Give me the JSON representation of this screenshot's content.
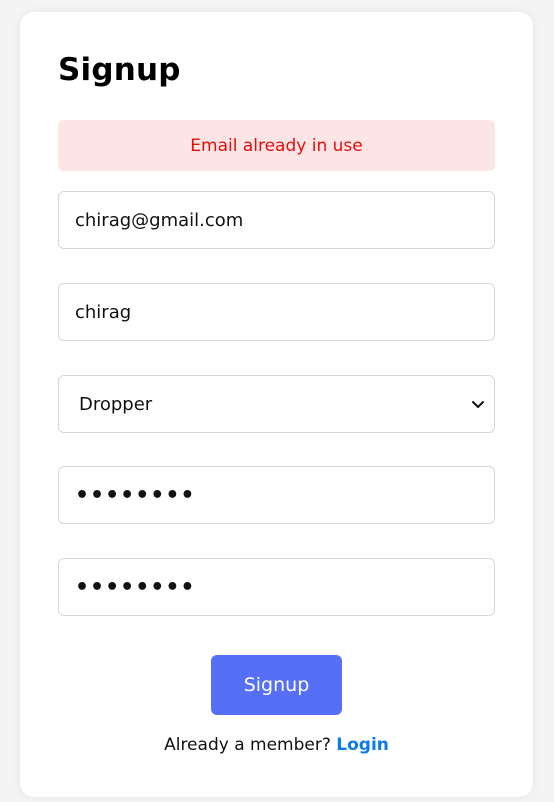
{
  "form": {
    "title": "Signup",
    "error": "Email already in use",
    "email": "chirag@gmail.com",
    "name": "chirag",
    "role": "Dropper",
    "password": "••••••••",
    "confirm_password": "••••••••",
    "submit_label": "Signup"
  },
  "footer": {
    "prompt": "Already a member?",
    "login_label": "Login"
  },
  "colors": {
    "accent": "#556ff7",
    "link": "#0b7be6",
    "error_bg": "#fde5e5",
    "error_text": "#e80d0d"
  },
  "icons": {
    "select": "chevron-down-icon"
  }
}
